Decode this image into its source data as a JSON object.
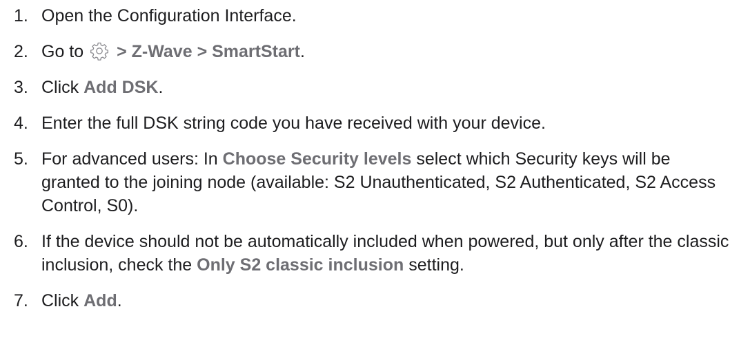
{
  "steps": [
    {
      "number": "1.",
      "text": "Open the Configuration Interface."
    },
    {
      "number": "2.",
      "prefix": "Go to",
      "icon": "gear-icon",
      "path": [
        "Z-Wave",
        "SmartStart"
      ],
      "separator": ">",
      "suffix": "."
    },
    {
      "number": "3.",
      "prefix": "Click",
      "ui": "Add DSK",
      "suffix": "."
    },
    {
      "number": "4.",
      "text": "Enter the full DSK string code you have received with your device."
    },
    {
      "number": "5.",
      "prefix": "For advanced users: In",
      "ui": "Choose Security levels",
      "suffix": "select which Security keys will be granted to the joining node (available: S2 Unauthenticated, S2 Authenticated, S2 Access Control, S0)."
    },
    {
      "number": "6.",
      "prefix": "If the device should not be automatically included when powered, but only after the classic inclusion, check the",
      "ui": "Only S2 classic inclusion",
      "suffix": "setting."
    },
    {
      "number": "7.",
      "prefix": "Click",
      "ui": "Add",
      "suffix": "."
    }
  ],
  "colors": {
    "text": "#1d1d1f",
    "ui_label": "#6e6e73",
    "icon": "#8a8a8f"
  }
}
